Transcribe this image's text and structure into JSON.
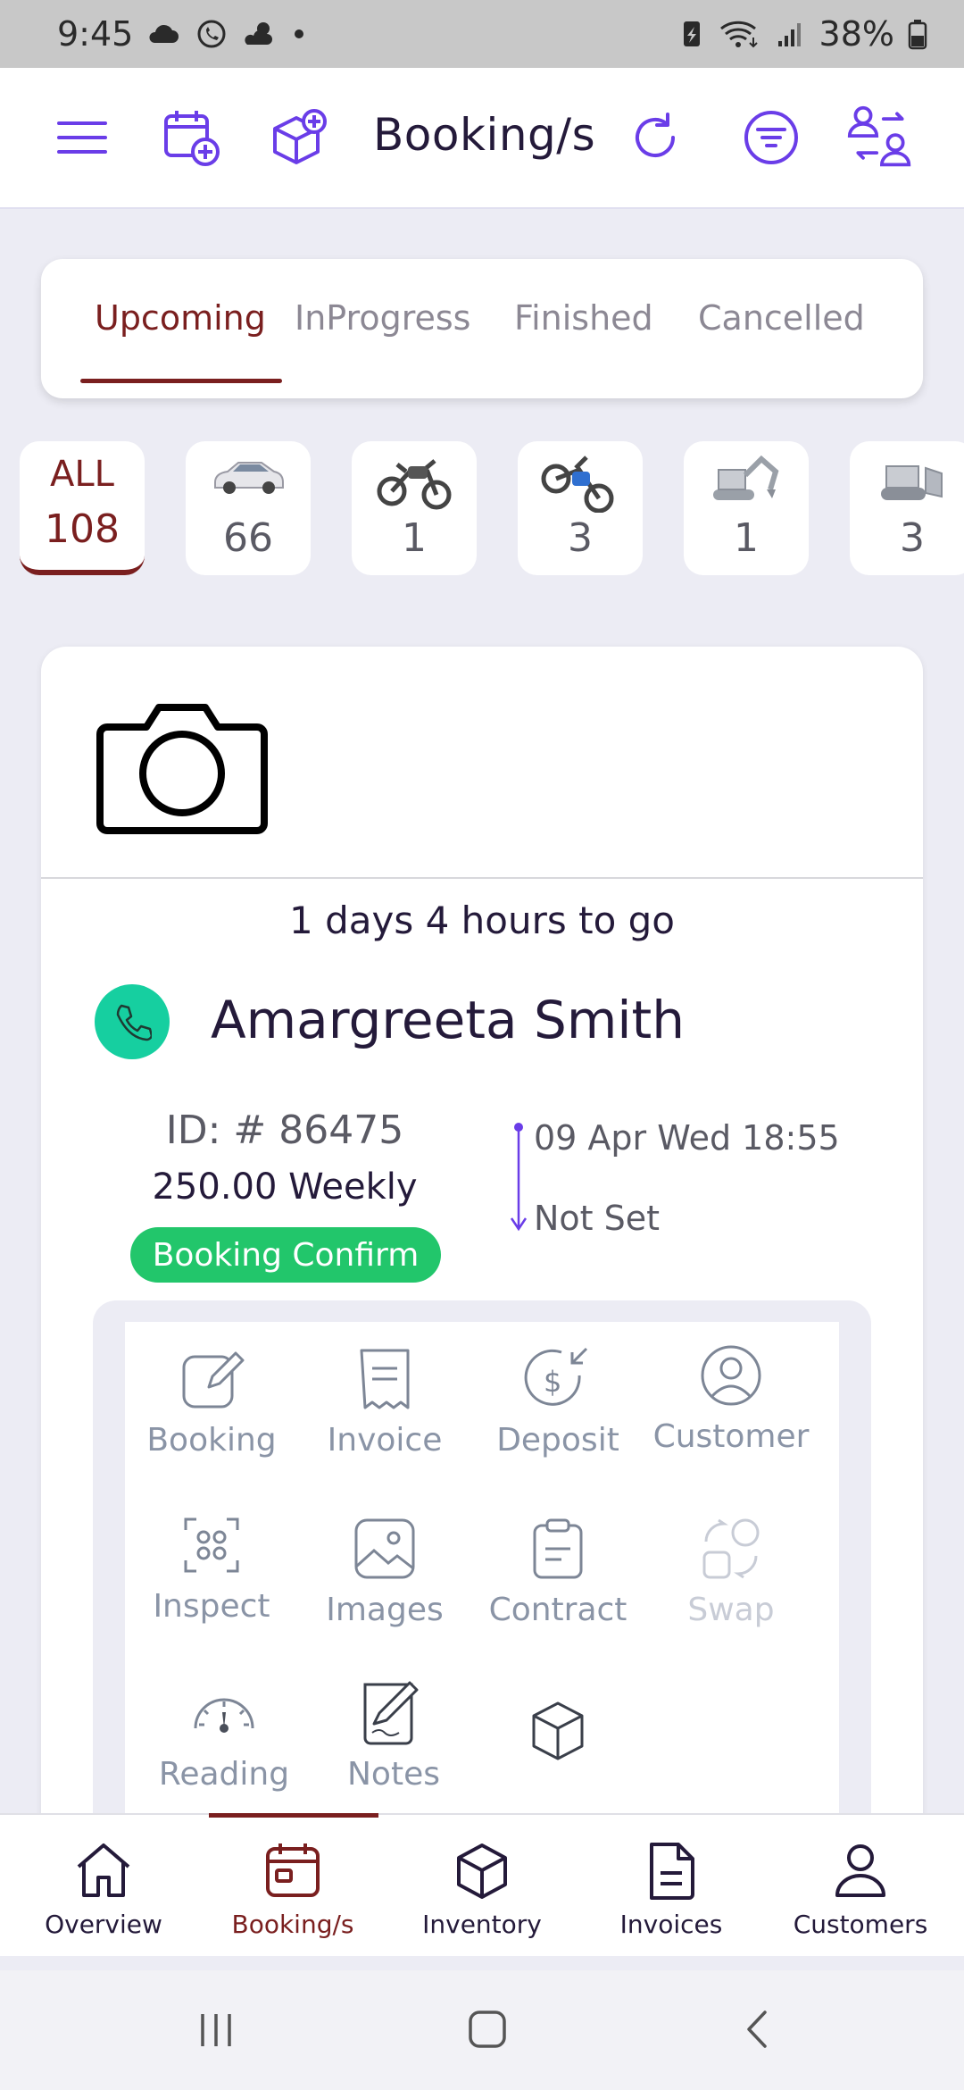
{
  "status_bar": {
    "time": "9:45",
    "battery": "38%",
    "icons": [
      "cloud-icon",
      "whatsapp-icon",
      "weather-icon",
      "dot-icon",
      "battery-saver-icon",
      "wifi-icon",
      "signal-icon",
      "battery-icon"
    ]
  },
  "header": {
    "title": "Booking/s",
    "icons": [
      "menu-icon",
      "calendar-add-icon",
      "box-add-icon",
      "refresh-icon",
      "filter-icon",
      "switch-user-icon"
    ],
    "accent": "#6a3de8"
  },
  "tabs": [
    {
      "label": "Upcoming",
      "active": true
    },
    {
      "label": "InProgress",
      "active": false
    },
    {
      "label": "Finished",
      "active": false
    },
    {
      "label": "Cancelled",
      "active": false
    }
  ],
  "categories": [
    {
      "label": "ALL",
      "count": "108",
      "icon": "all"
    },
    {
      "label": "",
      "count": "66",
      "icon": "car-icon"
    },
    {
      "label": "",
      "count": "1",
      "icon": "motorcycle-icon"
    },
    {
      "label": "",
      "count": "3",
      "icon": "dirt-bike-icon"
    },
    {
      "label": "",
      "count": "1",
      "icon": "excavator-icon"
    },
    {
      "label": "",
      "count": "3",
      "icon": "bulldozer-icon"
    }
  ],
  "booking": {
    "time_to_go": "1 days 4 hours to go",
    "customer_name": "Amargreeta Smith",
    "id_text": "ID: # 86475",
    "rate": "250.00 Weekly",
    "status": "Booking Confirm",
    "status_color": "#22c66b",
    "start": "09 Apr Wed 18:55",
    "end": "Not Set"
  },
  "actions": [
    {
      "label": "Booking",
      "icon": "edit-icon"
    },
    {
      "label": "Invoice",
      "icon": "invoice-icon"
    },
    {
      "label": "Deposit",
      "icon": "deposit-icon"
    },
    {
      "label": "Customer",
      "icon": "customer-icon"
    },
    {
      "label": "Inspect",
      "icon": "inspect-icon"
    },
    {
      "label": "Images",
      "icon": "images-icon"
    },
    {
      "label": "Contract",
      "icon": "contract-icon"
    },
    {
      "label": "Swap",
      "icon": "swap-icon",
      "disabled": true
    },
    {
      "label": "Reading",
      "icon": "gauge-icon"
    },
    {
      "label": "Notes",
      "icon": "notes-icon"
    },
    {
      "label": "",
      "icon": "cube-icon"
    }
  ],
  "bottom_nav": [
    {
      "label": "Overview",
      "icon": "home-icon"
    },
    {
      "label": "Booking/s",
      "icon": "calendar-icon",
      "active": true
    },
    {
      "label": "Inventory",
      "icon": "cube-icon"
    },
    {
      "label": "Invoices",
      "icon": "document-icon"
    },
    {
      "label": "Customers",
      "icon": "person-icon"
    }
  ],
  "colors": {
    "active": "#7a1f1f",
    "background": "#ececf4"
  }
}
